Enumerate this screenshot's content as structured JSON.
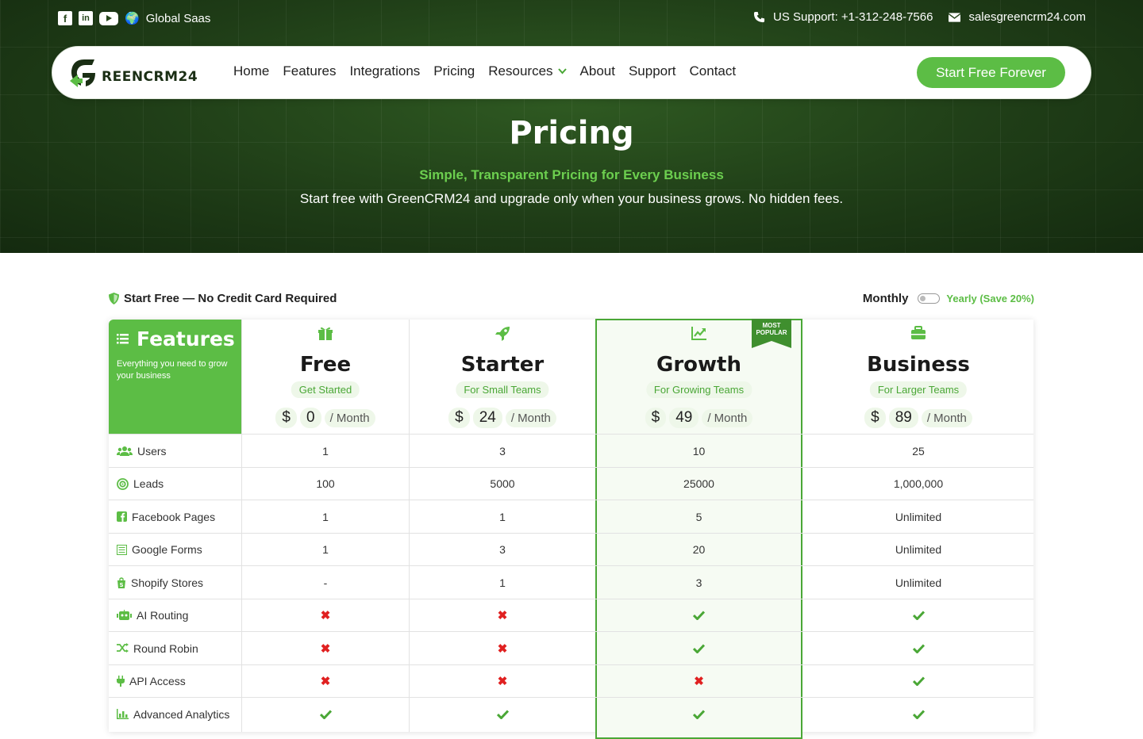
{
  "topbar": {
    "globe": "🌍",
    "region": "Global Saas",
    "phone": "US Support: +1-312-248-7566",
    "email": "salesgreencrm24.com"
  },
  "nav": {
    "logo_text": "REENCRM24",
    "links": [
      "Home",
      "Features",
      "Integrations",
      "Pricing",
      "Resources",
      "About",
      "Support",
      "Contact"
    ],
    "cta": "Start Free Forever"
  },
  "hero": {
    "title": "Pricing",
    "subtitle": "Simple, Transparent Pricing for Every Business",
    "description": "Start free with GreenCRM24 and upgrade only when your business grows. No hidden fees."
  },
  "billing": {
    "free_note": "Start Free — No Credit Card Required",
    "monthly": "Monthly",
    "yearly": "Yearly (Save 20%)"
  },
  "table": {
    "features_title": "Features",
    "features_desc": "Everything you need to grow your business",
    "ribbon": [
      "MOST",
      "POPULAR"
    ],
    "currency": "$",
    "per": "/ Month",
    "plans": [
      {
        "name": "Free",
        "tag": "Get Started",
        "price": "0",
        "icon": "gift-icon"
      },
      {
        "name": "Starter",
        "tag": "For Small Teams",
        "price": "24",
        "icon": "rocket-icon"
      },
      {
        "name": "Growth",
        "tag": "For Growing Teams",
        "price": "49",
        "icon": "chart-line-icon"
      },
      {
        "name": "Business",
        "tag": "For Larger Teams",
        "price": "89",
        "icon": "briefcase-icon"
      }
    ],
    "rows": [
      {
        "feature": "Users",
        "icon": "users-icon",
        "values": [
          "1",
          "3",
          "10",
          "25"
        ]
      },
      {
        "feature": "Leads",
        "icon": "target-icon",
        "values": [
          "100",
          "5000",
          "25000",
          "1,000,000"
        ]
      },
      {
        "feature": "Facebook Pages",
        "icon": "facebook-icon",
        "values": [
          "1",
          "1",
          "5",
          "Unlimited"
        ]
      },
      {
        "feature": "Google Forms",
        "icon": "form-icon",
        "values": [
          "1",
          "3",
          "20",
          "Unlimited"
        ]
      },
      {
        "feature": "Shopify Stores",
        "icon": "shopify-icon",
        "values": [
          "-",
          "1",
          "3",
          "Unlimited"
        ]
      },
      {
        "feature": "AI Routing",
        "icon": "robot-icon",
        "values": [
          "✗",
          "✗",
          "✓",
          "✓"
        ]
      },
      {
        "feature": "Round Robin",
        "icon": "shuffle-icon",
        "values": [
          "✗",
          "✗",
          "✓",
          "✓"
        ]
      },
      {
        "feature": "API Access",
        "icon": "plug-icon",
        "values": [
          "✗",
          "✗",
          "✗",
          "✓"
        ]
      },
      {
        "feature": "Advanced Analytics",
        "icon": "chart-bar-icon",
        "values": [
          "✓",
          "✓",
          "✓",
          "✓"
        ]
      }
    ]
  }
}
